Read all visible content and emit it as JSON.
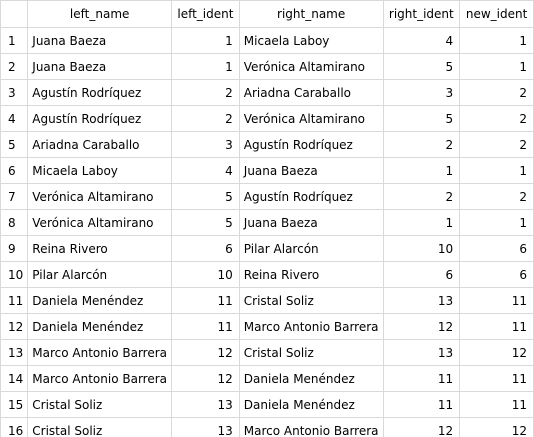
{
  "columns": [
    "left_name",
    "left_ident",
    "right_name",
    "right_ident",
    "new_ident"
  ],
  "rows": [
    {
      "n": "1",
      "left_name": "Juana Baeza",
      "left_ident": "1",
      "right_name": "Micaela Laboy",
      "right_ident": "4",
      "new_ident": "1"
    },
    {
      "n": "2",
      "left_name": "Juana Baeza",
      "left_ident": "1",
      "right_name": "Verónica Altamirano",
      "right_ident": "5",
      "new_ident": "1"
    },
    {
      "n": "3",
      "left_name": "Agustín Rodríquez",
      "left_ident": "2",
      "right_name": "Ariadna Caraballo",
      "right_ident": "3",
      "new_ident": "2"
    },
    {
      "n": "4",
      "left_name": "Agustín Rodríquez",
      "left_ident": "2",
      "right_name": "Verónica Altamirano",
      "right_ident": "5",
      "new_ident": "2"
    },
    {
      "n": "5",
      "left_name": "Ariadna Caraballo",
      "left_ident": "3",
      "right_name": "Agustín Rodríquez",
      "right_ident": "2",
      "new_ident": "2"
    },
    {
      "n": "6",
      "left_name": "Micaela Laboy",
      "left_ident": "4",
      "right_name": "Juana Baeza",
      "right_ident": "1",
      "new_ident": "1"
    },
    {
      "n": "7",
      "left_name": "Verónica Altamirano",
      "left_ident": "5",
      "right_name": "Agustín Rodríquez",
      "right_ident": "2",
      "new_ident": "2"
    },
    {
      "n": "8",
      "left_name": "Verónica Altamirano",
      "left_ident": "5",
      "right_name": "Juana Baeza",
      "right_ident": "1",
      "new_ident": "1"
    },
    {
      "n": "9",
      "left_name": "Reina Rivero",
      "left_ident": "6",
      "right_name": "Pilar Alarcón",
      "right_ident": "10",
      "new_ident": "6"
    },
    {
      "n": "10",
      "left_name": "Pilar Alarcón",
      "left_ident": "10",
      "right_name": "Reina Rivero",
      "right_ident": "6",
      "new_ident": "6"
    },
    {
      "n": "11",
      "left_name": "Daniela Menéndez",
      "left_ident": "11",
      "right_name": "Cristal Soliz",
      "right_ident": "13",
      "new_ident": "11"
    },
    {
      "n": "12",
      "left_name": "Daniela Menéndez",
      "left_ident": "11",
      "right_name": "Marco Antonio Barrera",
      "right_ident": "12",
      "new_ident": "11"
    },
    {
      "n": "13",
      "left_name": "Marco Antonio Barrera",
      "left_ident": "12",
      "right_name": "Cristal Soliz",
      "right_ident": "13",
      "new_ident": "12"
    },
    {
      "n": "14",
      "left_name": "Marco Antonio Barrera",
      "left_ident": "12",
      "right_name": "Daniela Menéndez",
      "right_ident": "11",
      "new_ident": "11"
    },
    {
      "n": "15",
      "left_name": "Cristal Soliz",
      "left_ident": "13",
      "right_name": "Daniela Menéndez",
      "right_ident": "11",
      "new_ident": "11"
    },
    {
      "n": "16",
      "left_name": "Cristal Soliz",
      "left_ident": "13",
      "right_name": "Marco Antonio Barrera",
      "right_ident": "12",
      "new_ident": "12"
    }
  ]
}
